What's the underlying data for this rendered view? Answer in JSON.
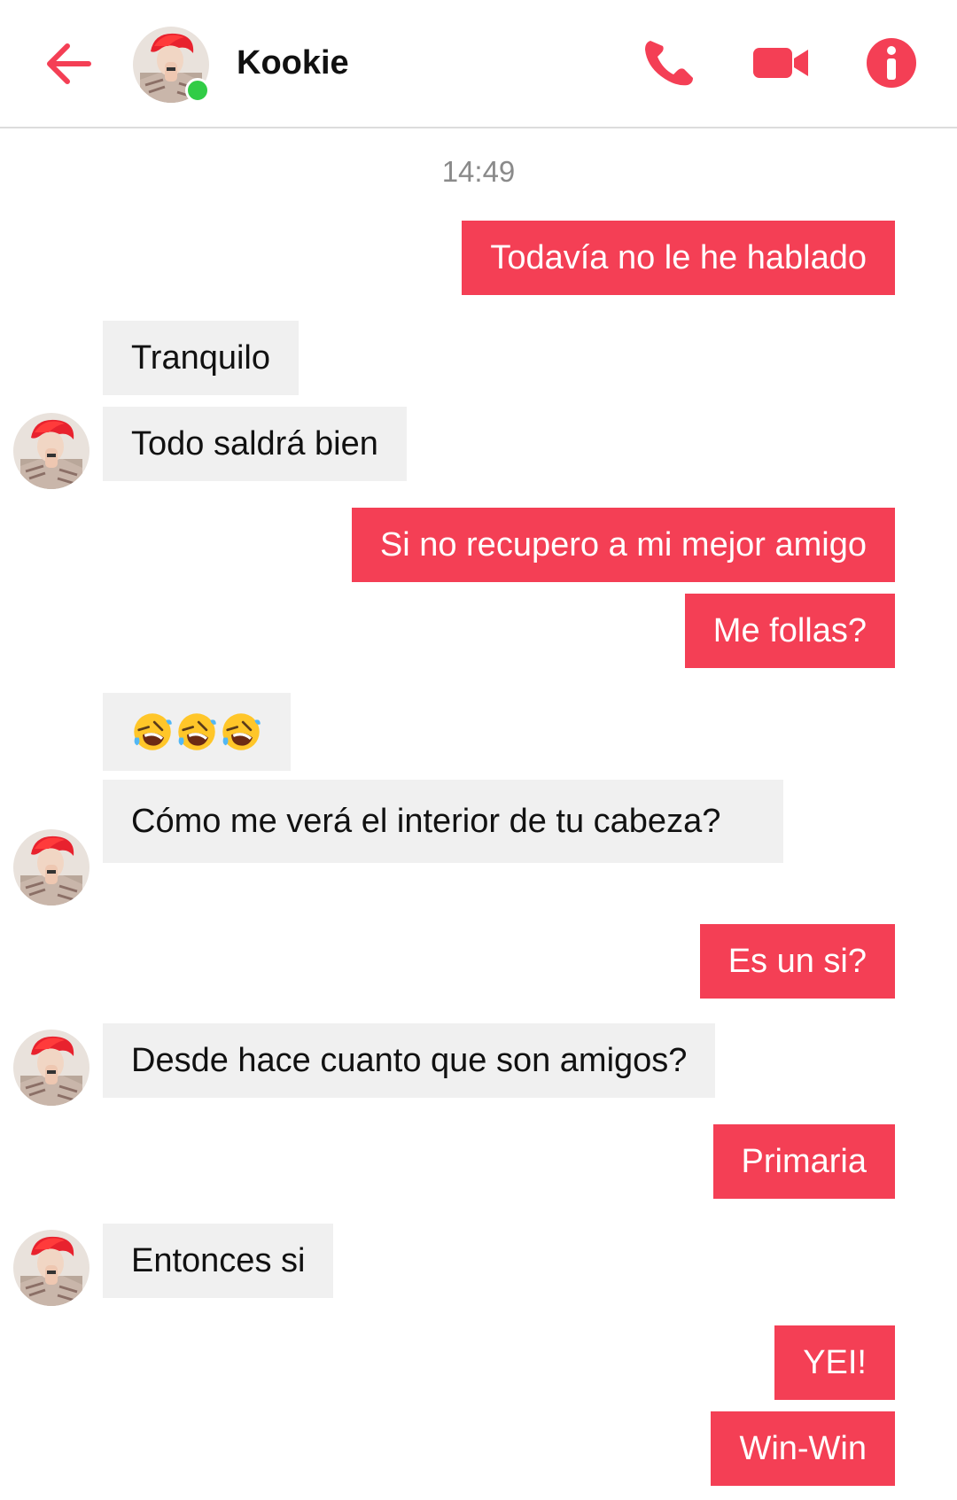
{
  "header": {
    "contact_name": "Kookie",
    "status": "online",
    "icons": [
      "arrow-left-icon",
      "phone-icon",
      "video-camera-icon",
      "info-icon"
    ]
  },
  "colors": {
    "accent": "#f43f55",
    "incoming_bubble": "#f0f0f0",
    "online": "#31cc46"
  },
  "conversation": {
    "timestamp": "14:49",
    "messages": [
      {
        "from": "me",
        "text": "Todavía no le he hablado"
      },
      {
        "from": "Kookie",
        "text": "Tranquilo"
      },
      {
        "from": "Kookie",
        "text": "Todo saldrá bien"
      },
      {
        "from": "me",
        "text": "Si no recupero a mi mejor amigo"
      },
      {
        "from": "me",
        "text": "Me follas?"
      },
      {
        "from": "Kookie",
        "text": "🤣🤣🤣"
      },
      {
        "from": "Kookie",
        "text": "Cómo me verá el interior de tu cabeza?"
      },
      {
        "from": "me",
        "text": "Es un si?"
      },
      {
        "from": "Kookie",
        "text": "Desde hace cuanto que son amigos?"
      },
      {
        "from": "me",
        "text": "Primaria"
      },
      {
        "from": "Kookie",
        "text": "Entonces si"
      },
      {
        "from": "me",
        "text": "YEI!"
      },
      {
        "from": "me",
        "text": "Win-Win"
      }
    ]
  }
}
